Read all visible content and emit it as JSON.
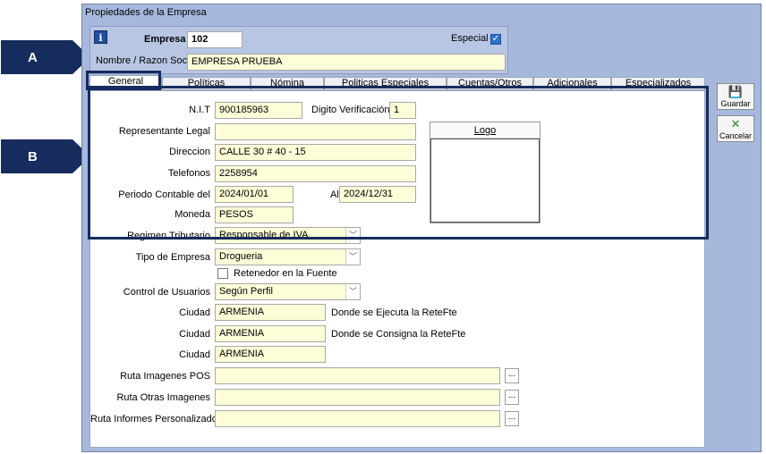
{
  "callouts": {
    "a": "A",
    "b": "B"
  },
  "window": {
    "title": "Propiedades de la Empresa"
  },
  "header": {
    "empresa_label": "Empresa",
    "empresa_value": "102",
    "especial_label": "Especial",
    "especial_checked": true,
    "nombre_label": "Nombre / Razon Social",
    "nombre_value": "EMPRESA PRUEBA"
  },
  "tabs": [
    "General",
    "Políticas",
    "Nómina",
    "Politicas Especiales",
    "Cuentas/Otros",
    "Adicionales",
    "Especializados"
  ],
  "active_tab": "General",
  "form": {
    "nit_label": "N.I.T",
    "nit_value": "900185963",
    "digito_label": "Digito Verificación :",
    "digito_value": "1",
    "representante_label": "Representante Legal",
    "representante_value": "",
    "direccion_label": "Direccion",
    "direccion_value": "CALLE 30 # 40 - 15",
    "telefonos_label": "Telefonos",
    "telefonos_value": "2258954",
    "periodo_label": "Periodo Contable del",
    "periodo_from": "2024/01/01",
    "al_label": "Al",
    "periodo_to": "2024/12/31",
    "moneda_label": "Moneda",
    "moneda_value": "PESOS",
    "regimen_label": "Regimen Tributario",
    "regimen_value": "Responsable de IVA",
    "tipo_label": "Tipo de Empresa",
    "tipo_value": "Drogueria",
    "retenedor_label": "Retenedor en la Fuente",
    "retenedor_checked": false,
    "control_label": "Control de Usuarios",
    "control_value": "Según Perfil",
    "ciudad_label": "Ciudad",
    "ciudad1_value": "ARMENIA",
    "ciudad1_note": "Donde se Ejecuta  la ReteFte",
    "ciudad2_value": "ARMENIA",
    "ciudad2_note": "Donde se Consigna la ReteFte",
    "ciudad3_value": "ARMENIA",
    "ruta_pos_label": "Ruta Imagenes POS",
    "ruta_pos_value": "",
    "ruta_otras_label": "Ruta Otras Imagenes",
    "ruta_otras_value": "",
    "ruta_informes_label": "Ruta Informes Personalizados",
    "ruta_informes_value": "",
    "browse_label": "...",
    "logo_label": "Logo"
  },
  "side_buttons": {
    "guardar": "Guardar",
    "cancelar": "Cancelar"
  },
  "icons": {
    "info": "info-icon",
    "save": "floppy-disk-icon",
    "cancel": "x-cancel-icon"
  },
  "colors": {
    "callout": "#152c5c",
    "window_bg": "#a6b9dd",
    "field_bg": "#fdfdd8",
    "checkbox": "#2f70c9"
  }
}
